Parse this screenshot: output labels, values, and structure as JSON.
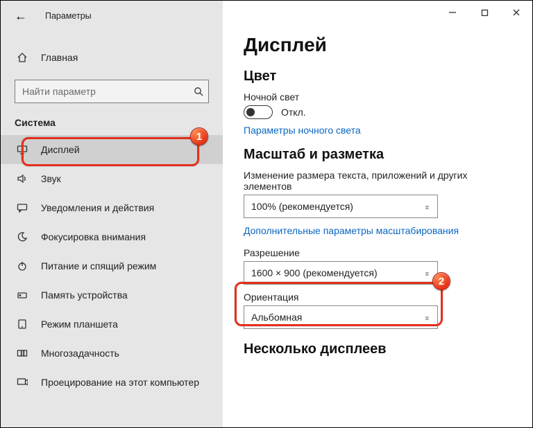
{
  "window": {
    "title": "Параметры"
  },
  "home_label": "Главная",
  "search": {
    "placeholder": "Найти параметр"
  },
  "group_title": "Система",
  "nav": [
    {
      "label": "Дисплей"
    },
    {
      "label": "Звук"
    },
    {
      "label": "Уведомления и действия"
    },
    {
      "label": "Фокусировка внимания"
    },
    {
      "label": "Питание и спящий режим"
    },
    {
      "label": "Память устройства"
    },
    {
      "label": "Режим планшета"
    },
    {
      "label": "Многозадачность"
    },
    {
      "label": "Проецирование на этот компьютер"
    }
  ],
  "content": {
    "title": "Дисплей",
    "section_color": "Цвет",
    "nightlight_label": "Ночной свет",
    "nightlight_state": "Откл.",
    "nightlight_link": "Параметры ночного света",
    "section_scale": "Масштаб и разметка",
    "scale_label": "Изменение размера текста, приложений и других элементов",
    "scale_value": "100% (рекомендуется)",
    "scale_link": "Дополнительные параметры масштабирования",
    "resolution_label": "Разрешение",
    "resolution_value": "1600 × 900 (рекомендуется)",
    "orientation_label": "Ориентация",
    "orientation_value": "Альбомная",
    "section_multi": "Несколько дисплеев"
  },
  "annotations": {
    "badge1": "1",
    "badge2": "2"
  }
}
